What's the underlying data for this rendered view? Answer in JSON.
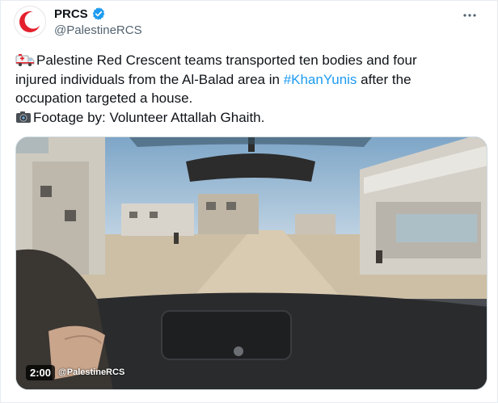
{
  "tweet": {
    "display_name": "PRCS",
    "handle": "@PalestineRCS",
    "icons": {
      "avatar": "red-crescent-logo",
      "verified": "verified-badge-icon",
      "more": "more-options-icon",
      "ambulance": "ambulance-emoji",
      "camera": "camera-emoji"
    },
    "text": {
      "line1": "Palestine Red Crescent teams transported ten bodies and four",
      "line2_pre": "injured individuals from the Al-Balad area in ",
      "hashtag": "#KhanYunis",
      "line2_post": " after the",
      "line3": "occupation targeted a house.",
      "line4": "Footage by: Volunteer Attallah Ghaith."
    },
    "media": {
      "duration": "2:00",
      "watermark": "@PalestineRCS"
    },
    "colors": {
      "brand_red": "#e4202c",
      "link_blue": "#1d9bf0",
      "verified_blue": "#1d9bf0",
      "secondary_text": "#536471"
    }
  }
}
